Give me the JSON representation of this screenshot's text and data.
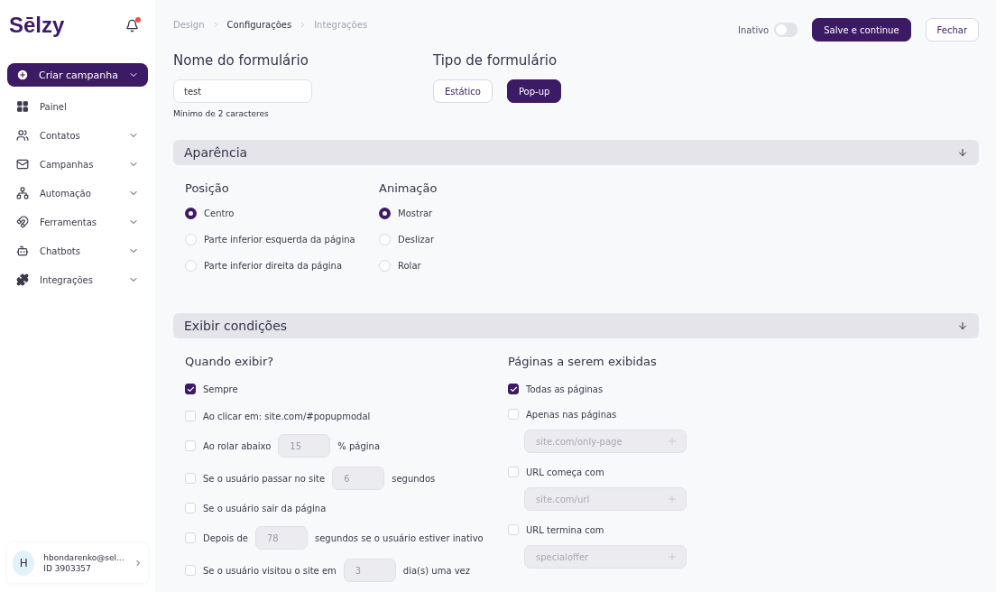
{
  "sidebar": {
    "logo": "Sēlzy",
    "notification_dot": true,
    "create_button": "Criar campanha",
    "items": [
      {
        "label": "Painel",
        "expandable": false
      },
      {
        "label": "Contatos",
        "expandable": true
      },
      {
        "label": "Campanhas",
        "expandable": true
      },
      {
        "label": "Automação",
        "expandable": true
      },
      {
        "label": "Ferramentas",
        "expandable": true
      },
      {
        "label": "Chatbots",
        "expandable": true
      },
      {
        "label": "Integrações",
        "expandable": true
      }
    ],
    "user": {
      "initial": "H",
      "email": "hbondarenko@sel...",
      "id": "ID 3903357"
    }
  },
  "breadcrumbs": [
    {
      "label": "Design",
      "selected": false
    },
    {
      "label": "Configurações",
      "selected": true
    },
    {
      "label": "Integrações",
      "selected": false
    }
  ],
  "header": {
    "status_label": "Inativo",
    "status_on": false,
    "save_button": "Salve e continue",
    "close_button": "Fechar"
  },
  "form_name": {
    "title": "Nome do formulário",
    "value": "test",
    "hint": "Mínimo de 2 caracteres"
  },
  "form_type": {
    "title": "Tipo de formulário",
    "options": [
      {
        "label": "Estático",
        "selected": false
      },
      {
        "label": "Pop-up",
        "selected": true
      }
    ]
  },
  "appearance": {
    "title": "Aparência",
    "expanded": true,
    "groups": [
      {
        "title": "Posição",
        "options": [
          {
            "label": "Centro",
            "selected": true
          },
          {
            "label": "Parte inferior esquerda da página",
            "selected": false
          },
          {
            "label": "Parte inferior direita da página",
            "selected": false
          }
        ]
      },
      {
        "title": "Animação",
        "options": [
          {
            "label": "Mostrar",
            "selected": true
          },
          {
            "label": "Deslizar",
            "selected": false
          },
          {
            "label": "Rolar",
            "selected": false
          }
        ]
      }
    ]
  },
  "display_conditions": {
    "title": "Exibir condições",
    "expanded": true,
    "when": {
      "title": "Quando exibir?",
      "items": [
        {
          "kind": "plain",
          "label": "Sempre",
          "checked": true
        },
        {
          "kind": "plain",
          "label": "Ao clicar em: site.com/#popupmodal",
          "checked": false
        },
        {
          "kind": "number",
          "label": "Ao rolar abaixo",
          "value": "15",
          "suffix": "% página",
          "checked": false
        },
        {
          "kind": "number",
          "label": "Se o usuário passar no site",
          "value": "6",
          "suffix": "segundos",
          "checked": false
        },
        {
          "kind": "plain",
          "label": "Se o usuário sair da página",
          "checked": false
        },
        {
          "kind": "number",
          "label": "Depois de",
          "value": "78",
          "suffix": "segundos se o usuário estiver inativo",
          "checked": false
        },
        {
          "kind": "number",
          "label": "Se o usuário visitou o site em",
          "value": "3",
          "suffix": "dia(s) uma vez",
          "checked": false
        }
      ]
    },
    "pages": {
      "title": "Páginas a serem exibidas",
      "items": [
        {
          "kind": "plain",
          "label": "Todas as páginas",
          "checked": true
        },
        {
          "kind": "url",
          "label": "Apenas nas páginas",
          "placeholder": "site.com/only-page",
          "checked": false
        },
        {
          "kind": "url",
          "label": "URL começa com",
          "placeholder": "site.com/url",
          "checked": false
        },
        {
          "kind": "url",
          "label": "URL termina com",
          "placeholder": "specialoffer",
          "checked": false
        }
      ]
    }
  }
}
